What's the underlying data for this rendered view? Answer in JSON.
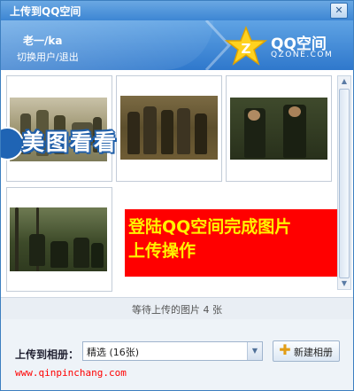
{
  "window": {
    "title": "上传到QQ空间",
    "close_glyph": "✕"
  },
  "banner": {
    "username": "老一/ka",
    "switch_text": "切换用户/退出",
    "brand_title": "QQ空间",
    "brand_sub": "QZONE.COM"
  },
  "overlay": {
    "watermark_text": "美图看看",
    "notice_line1": "登陆QQ空间完成图片",
    "notice_line2": "上传操作"
  },
  "status": {
    "pending_text": "等待上传的图片  4  张"
  },
  "footer": {
    "album_label": "上传到相册：",
    "album_value": "精选 (16张)",
    "new_album_label": "新建相册",
    "url": "www.qinpinchang.com"
  },
  "colors": {
    "accent": "#3d86d3",
    "notice_bg": "#ff0000",
    "notice_text": "#fff200",
    "url": "#ff0000"
  }
}
